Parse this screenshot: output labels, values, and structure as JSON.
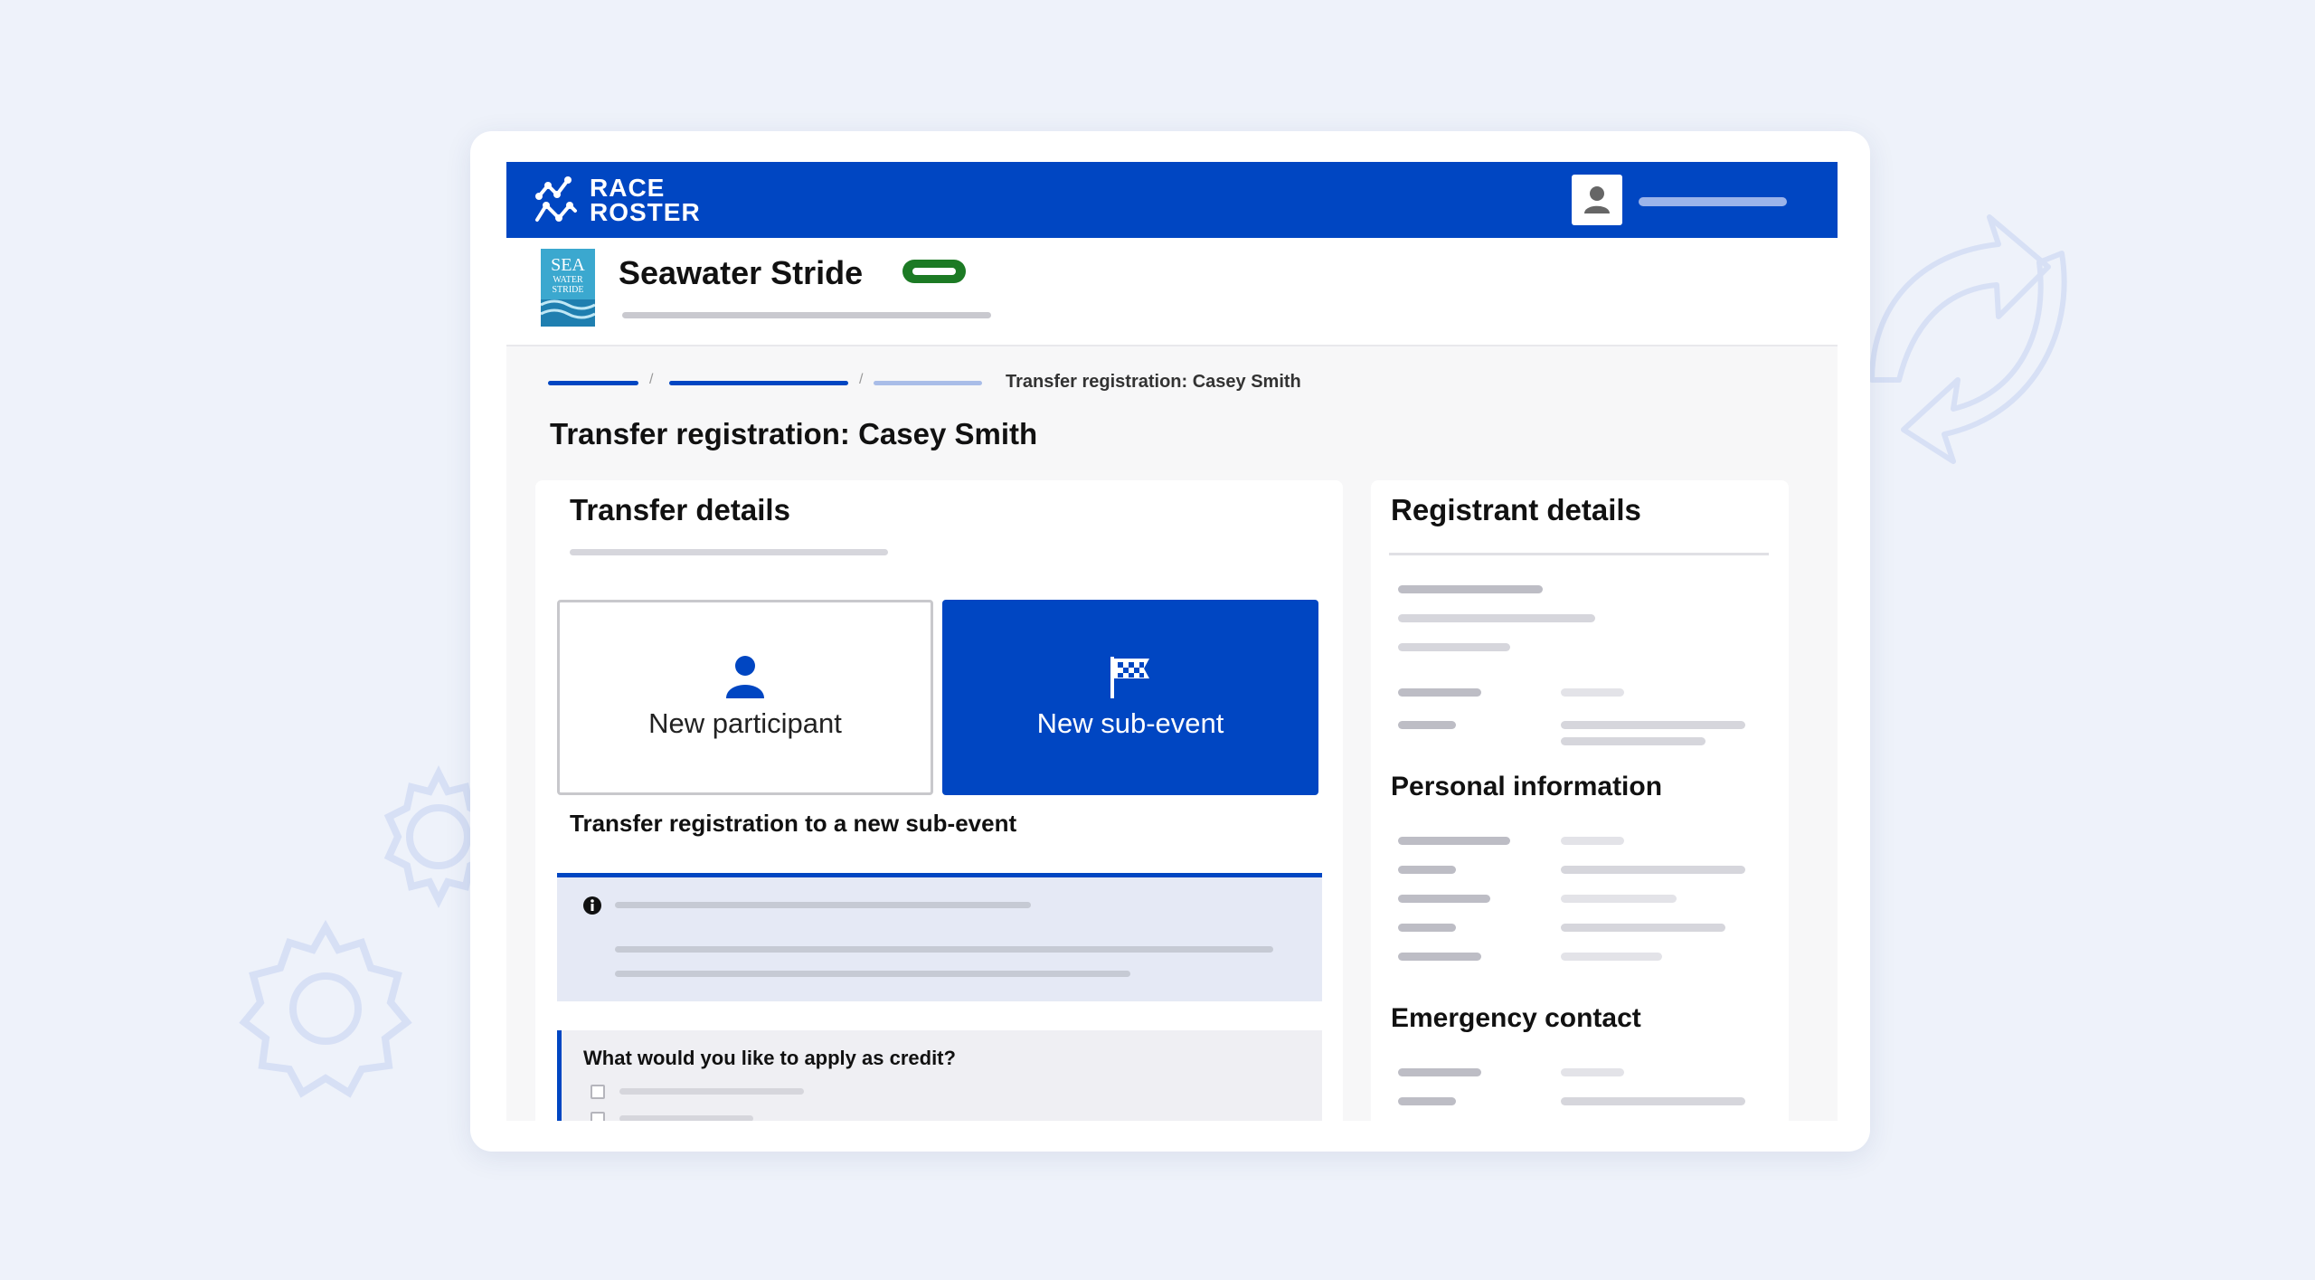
{
  "app": {
    "logo_line1": "RACE",
    "logo_line2": "ROSTER"
  },
  "event": {
    "name": "Seawater Stride",
    "logo_text_top": "SEA",
    "logo_text_mid": "WATER",
    "logo_text_bot": "STRIDE"
  },
  "breadcrumb": {
    "current": "Transfer registration: Casey Smith"
  },
  "page": {
    "title": "Transfer registration: Casey Smith"
  },
  "transfer": {
    "title": "Transfer details",
    "options": [
      {
        "label": "New participant",
        "icon": "person-icon",
        "selected": false
      },
      {
        "label": "New sub-event",
        "icon": "checkered-flag-icon",
        "selected": true
      }
    ],
    "subheading": "Transfer registration to a new sub-event",
    "credit_question": "What would you like to apply as credit?"
  },
  "registrant": {
    "title": "Registrant details",
    "personal_title": "Personal information",
    "emergency_title": "Emergency contact"
  },
  "colors": {
    "brand": "#0046c2",
    "status": "#1c7a24",
    "background": "#eef2fa"
  }
}
